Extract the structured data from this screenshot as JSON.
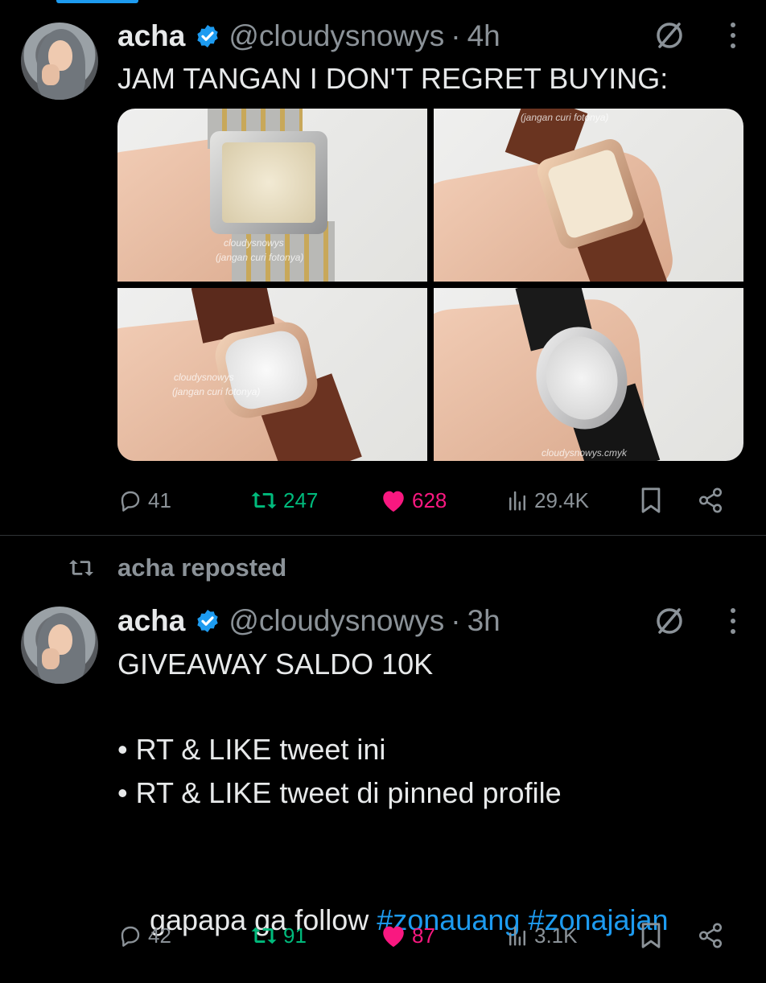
{
  "tweets": [
    {
      "author_name": "acha",
      "handle": "@cloudysnowys",
      "time": "4h",
      "text": "JAM TANGAN I DON'T REGRET BUYING:",
      "media_watermarks": [
        "cloudysnowys\n(jangan curi fotonya)",
        "(jangan curi fotonya)",
        "cloudysnowys\n(jangan curi fotonya)",
        "cloudysnowys.cmyk"
      ],
      "stats": {
        "replies": "41",
        "reposts": "247",
        "likes": "628",
        "views": "29.4K"
      }
    },
    {
      "repost_label": "acha reposted",
      "author_name": "acha",
      "handle": "@cloudysnowys",
      "time": "3h",
      "text_line1": "GIVEAWAY SALDO 10K",
      "bullet1": "• RT & LIKE tweet ini",
      "bullet2": "• RT & LIKE tweet di pinned profile",
      "text_last": "gapapa ga follow ",
      "hashtag1": "#zonauang",
      "hashtag2": "#zonajajan",
      "stats": {
        "replies": "42",
        "reposts": "91",
        "likes": "87",
        "views": "3.1K"
      }
    }
  ],
  "colors": {
    "accent": "#1d9bf0",
    "repost": "#00ba7c",
    "like": "#f91880",
    "muted": "#8b9298"
  }
}
